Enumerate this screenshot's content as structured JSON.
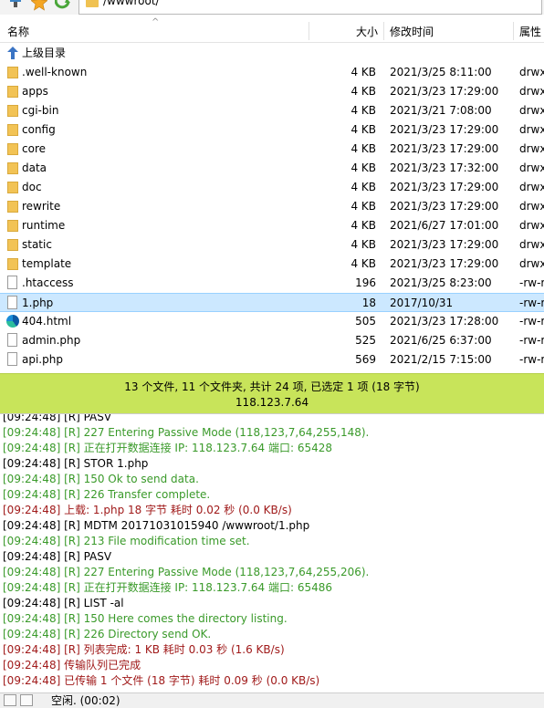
{
  "toolbar": {
    "path": "/wwwroot/",
    "icons": [
      "network-icon",
      "star-icon",
      "refresh-icon"
    ]
  },
  "columns": {
    "name": "名称",
    "size": "大小",
    "modified": "修改时间",
    "perm": "属性"
  },
  "parent_dir": "上级目录",
  "files": [
    {
      "name": ".well-known",
      "type": "folder",
      "size": "4 KB",
      "date": "2021/3/25 8:11:00",
      "perm": "drwx"
    },
    {
      "name": "apps",
      "type": "folder",
      "size": "4 KB",
      "date": "2021/3/23 17:29:00",
      "perm": "drwx"
    },
    {
      "name": "cgi-bin",
      "type": "folder",
      "size": "4 KB",
      "date": "2021/3/21 7:08:00",
      "perm": "drwx"
    },
    {
      "name": "config",
      "type": "folder",
      "size": "4 KB",
      "date": "2021/3/23 17:29:00",
      "perm": "drwx"
    },
    {
      "name": "core",
      "type": "folder",
      "size": "4 KB",
      "date": "2021/3/23 17:29:00",
      "perm": "drwx"
    },
    {
      "name": "data",
      "type": "folder",
      "size": "4 KB",
      "date": "2021/3/23 17:32:00",
      "perm": "drwx"
    },
    {
      "name": "doc",
      "type": "folder",
      "size": "4 KB",
      "date": "2021/3/23 17:29:00",
      "perm": "drwx"
    },
    {
      "name": "rewrite",
      "type": "folder",
      "size": "4 KB",
      "date": "2021/3/23 17:29:00",
      "perm": "drwx"
    },
    {
      "name": "runtime",
      "type": "folder",
      "size": "4 KB",
      "date": "2021/6/27 17:01:00",
      "perm": "drwx"
    },
    {
      "name": "static",
      "type": "folder",
      "size": "4 KB",
      "date": "2021/3/23 17:29:00",
      "perm": "drwx"
    },
    {
      "name": "template",
      "type": "folder",
      "size": "4 KB",
      "date": "2021/3/23 17:29:00",
      "perm": "drwx"
    },
    {
      "name": ".htaccess",
      "type": "file",
      "size": "196",
      "date": "2021/3/25 8:23:00",
      "perm": "-rw-r"
    },
    {
      "name": "1.php",
      "type": "file",
      "size": "18",
      "date": "2017/10/31",
      "perm": "-rw-r",
      "selected": true
    },
    {
      "name": "404.html",
      "type": "edge",
      "size": "505",
      "date": "2021/3/23 17:28:00",
      "perm": "-rw-r"
    },
    {
      "name": "admin.php",
      "type": "file",
      "size": "525",
      "date": "2021/6/25 6:37:00",
      "perm": "-rw-r"
    },
    {
      "name": "api.php",
      "type": "file",
      "size": "569",
      "date": "2021/2/15 7:15:00",
      "perm": "-rw-r"
    }
  ],
  "status": {
    "summary": "13 个文件, 11 个文件夹, 共计 24 项, 已选定 1 项 (18 字节)",
    "ip": "118.123.7.64"
  },
  "log": [
    {
      "text": "[09:24:48] [R] PASV",
      "color": "black"
    },
    {
      "text": "[09:24:48] [R] 227 Entering Passive Mode (118,123,7,64,255,148).",
      "color": "green"
    },
    {
      "text": "[09:24:48] [R] 正在打开数据连接 IP: 118.123.7.64 端口: 65428",
      "color": "green"
    },
    {
      "text": "[09:24:48] [R] STOR 1.php",
      "color": "black"
    },
    {
      "text": "[09:24:48] [R] 150 Ok to send data.",
      "color": "green"
    },
    {
      "text": "[09:24:48] [R] 226 Transfer complete.",
      "color": "green"
    },
    {
      "text": "[09:24:48] 上载: 1.php 18 字节 耗时 0.02 秒 (0.0 KB/s)",
      "color": "red"
    },
    {
      "text": "[09:24:48] [R] MDTM 20171031015940 /wwwroot/1.php",
      "color": "black"
    },
    {
      "text": "[09:24:48] [R] 213 File modification time set.",
      "color": "green"
    },
    {
      "text": "[09:24:48] [R] PASV",
      "color": "black"
    },
    {
      "text": "[09:24:48] [R] 227 Entering Passive Mode (118,123,7,64,255,206).",
      "color": "green"
    },
    {
      "text": "[09:24:48] [R] 正在打开数据连接 IP: 118.123.7.64 端口: 65486",
      "color": "green"
    },
    {
      "text": "[09:24:48] [R] LIST -al",
      "color": "black"
    },
    {
      "text": "[09:24:48] [R] 150 Here comes the directory listing.",
      "color": "green"
    },
    {
      "text": "[09:24:48] [R] 226 Directory send OK.",
      "color": "green"
    },
    {
      "text": "[09:24:48] [R] 列表完成: 1 KB 耗时 0.03 秒 (1.6 KB/s)",
      "color": "red"
    },
    {
      "text": "[09:24:48] 传输队列已完成",
      "color": "red"
    },
    {
      "text": "[09:24:48] 已传输 1 个文件 (18 字节) 耗时 0.09 秒 (0.0 KB/s)",
      "color": "red"
    }
  ],
  "bottom": {
    "status": "空闲. (00:02)"
  }
}
